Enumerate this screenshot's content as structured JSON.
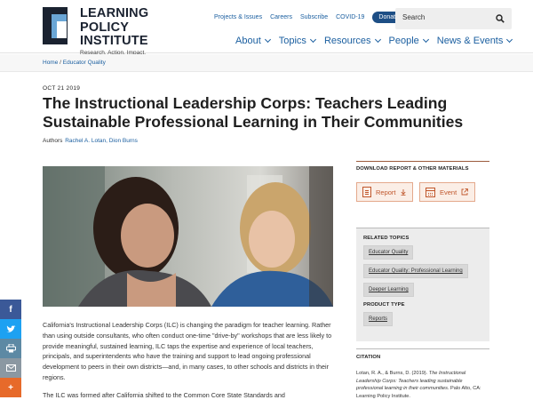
{
  "brand": {
    "name_line1": "LEARNING",
    "name_line2": "POLICY",
    "name_line3": "INSTITUTE",
    "tagline": "Research. Action. Impact."
  },
  "utility_nav": [
    "Projects & Issues",
    "Careers",
    "Subscribe",
    "COVID-19"
  ],
  "donate_label": "Donate",
  "search": {
    "placeholder": "Search"
  },
  "main_nav": [
    "About",
    "Topics",
    "Resources",
    "People",
    "News & Events"
  ],
  "breadcrumb": {
    "home": "Home",
    "separator": " / ",
    "current": "Educator Quality"
  },
  "article": {
    "date": "OCT 21 2019",
    "title": "The Instructional Leadership Corps: Teachers Leading Sustainable Professional Learning in Their Communities",
    "authors_label": "Authors",
    "authors": "Rachel A. Lotan, Dion Burns",
    "paragraph1": "California's Instructional Leadership Corps (ILC) is changing the paradigm for teacher learning. Rather than using outside consultants, who often conduct one-time \"drive-by\" workshops that are less likely to provide meaningful, sustained learning, ILC taps the expertise and experience of local teachers, principals, and superintendents who have the training and support to lead ongoing professional development to peers in their own districts—and, in many cases, to other schools and districts in their regions.",
    "paragraph2": "The ILC was formed after California shifted to the Common Core State Standards and"
  },
  "share": {
    "facebook": "f",
    "twitter": "t",
    "print": "⎙",
    "email": "✉",
    "more": "+"
  },
  "sidebar": {
    "download_heading": "DOWNLOAD REPORT & OTHER MATERIALS",
    "report_label": "Report",
    "event_label": "Event",
    "related_heading": "RELATED TOPICS",
    "topics": [
      "Educator Quality",
      "Educator Quality: Professional Learning",
      "Deeper Learning"
    ],
    "product_type_heading": "PRODUCT TYPE",
    "product_types": [
      "Reports"
    ],
    "citation_heading": "CITATION",
    "citation_prefix": "Lotan, R. A., & Burns, D. (2019). ",
    "citation_title": "The Instructional Leadership Corps: Teachers leading sustainable professional learning in their communities.",
    "citation_suffix": " Palo Alto, CA: Learning Policy Institute."
  },
  "colors": {
    "link": "#1b5fa0",
    "donate": "#1d4e85",
    "accent": "#c0572c",
    "logo_dark": "#1a2230",
    "logo_blue": "#6aa6d6"
  }
}
